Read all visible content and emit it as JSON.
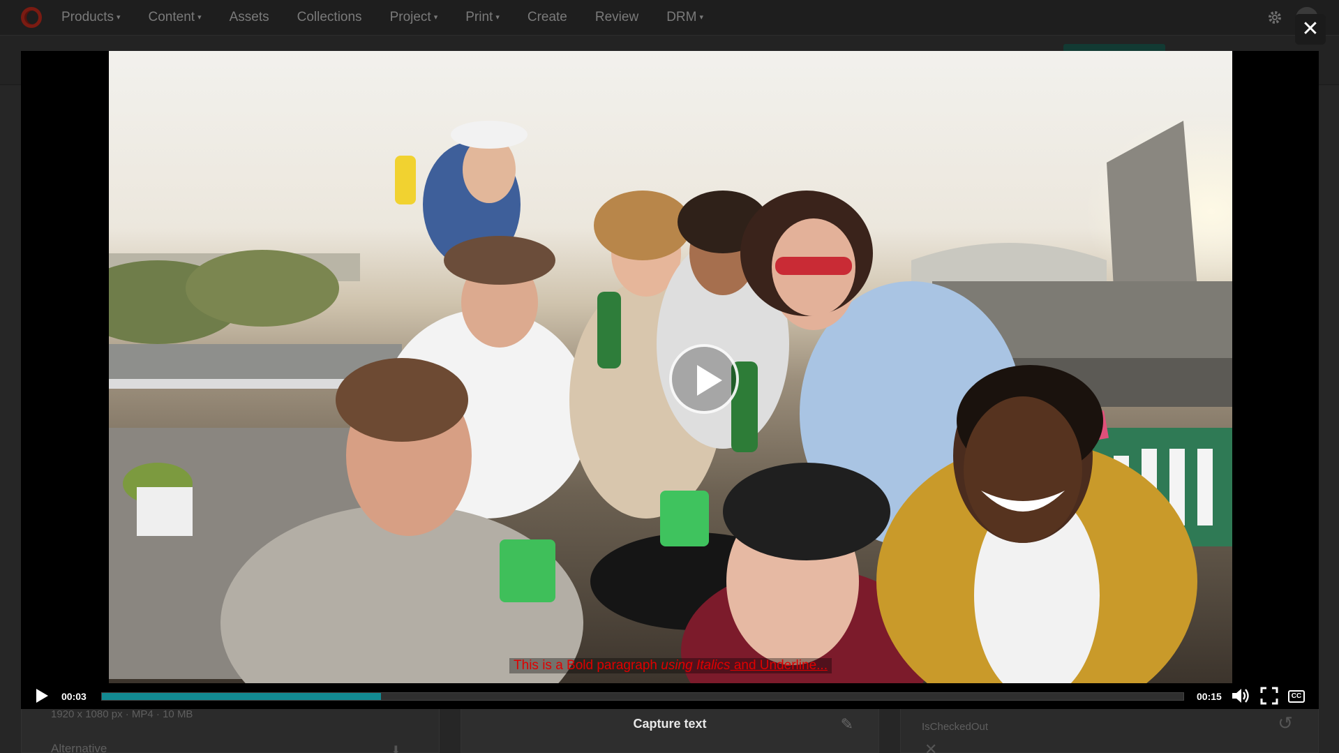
{
  "nav": {
    "items": [
      {
        "label": "Products",
        "dropdown": true
      },
      {
        "label": "Content",
        "dropdown": true
      },
      {
        "label": "Assets",
        "dropdown": false
      },
      {
        "label": "Collections",
        "dropdown": false
      },
      {
        "label": "Project",
        "dropdown": true
      },
      {
        "label": "Print",
        "dropdown": true
      },
      {
        "label": "Create",
        "dropdown": false
      },
      {
        "label": "Review",
        "dropdown": false
      },
      {
        "label": "DRM",
        "dropdown": true
      }
    ],
    "caret": "▾",
    "gear_icon": "gear-icon",
    "brand_color": "#7a1b12"
  },
  "panels": {
    "left_meta": "1920 x 1080 px · MP4 · 10 MB",
    "left_rendition": "Alternative",
    "middle_title": "Capture text",
    "right_label": "IsCheckedOut"
  },
  "viewer": {
    "close_symbol": "✕",
    "caption": {
      "bold": "This is a Bold paragraph ",
      "italic": "using Italics",
      "underline": " and Underline..."
    },
    "caption_color": "#e00000",
    "current_time": "00:03",
    "duration": "00:15",
    "progress": 0.258,
    "progress_color": "#128a92",
    "cc_label": "CC"
  }
}
